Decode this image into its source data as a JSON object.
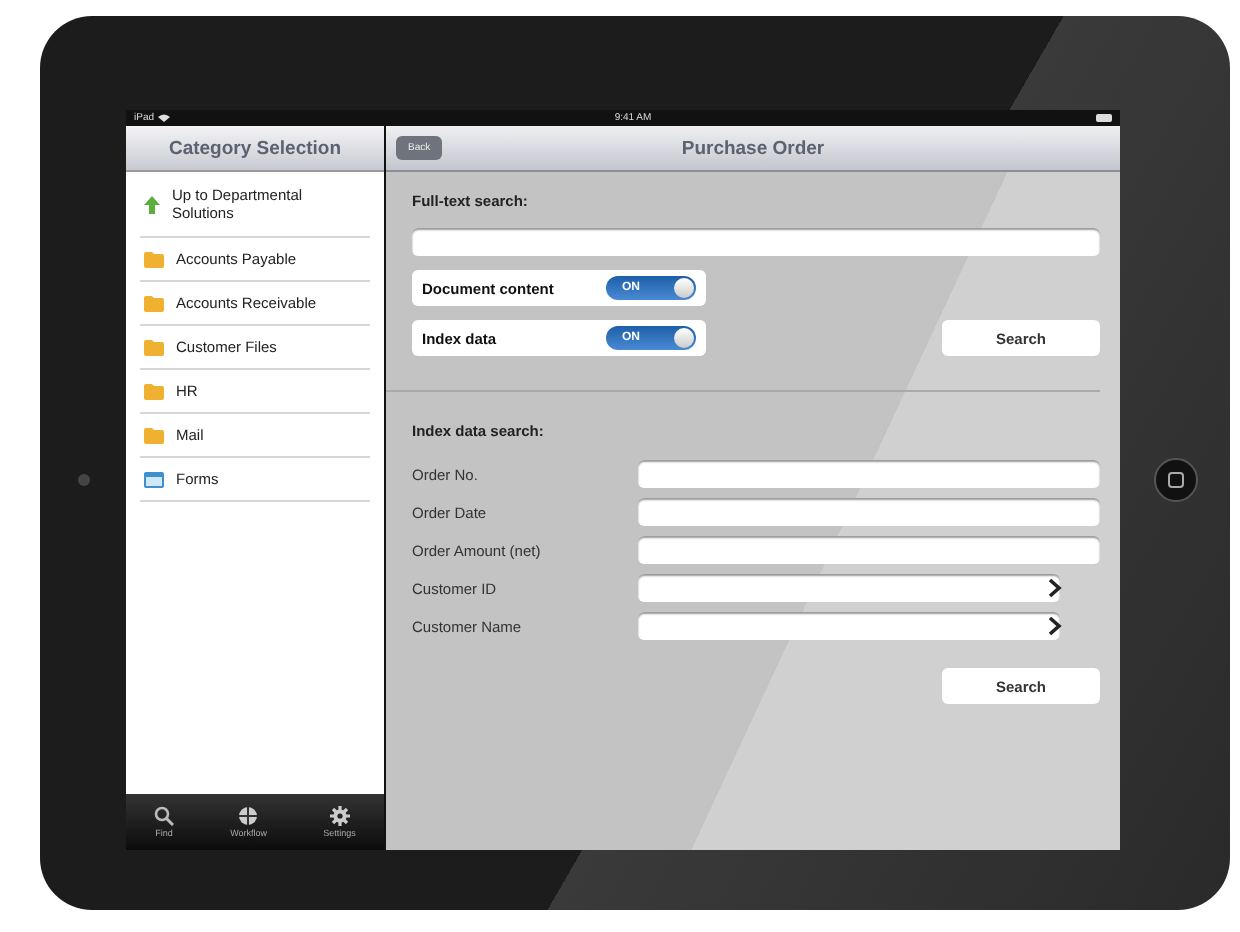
{
  "status_bar": {
    "device": "iPad",
    "time": "9:41 AM"
  },
  "sidebar": {
    "title": "Category Selection",
    "items": [
      {
        "label": "Up to Departmental Solutions",
        "kind": "up"
      },
      {
        "label": "Accounts Payable",
        "kind": "folder"
      },
      {
        "label": "Accounts Receivable",
        "kind": "folder"
      },
      {
        "label": "Customer Files",
        "kind": "folder"
      },
      {
        "label": "HR",
        "kind": "folder"
      },
      {
        "label": "Mail",
        "kind": "folder"
      },
      {
        "label": "Forms",
        "kind": "form"
      }
    ],
    "tabs": [
      {
        "label": "Find",
        "kind": "find"
      },
      {
        "label": "Workflow",
        "kind": "workflow"
      },
      {
        "label": "Settings",
        "kind": "settings"
      }
    ]
  },
  "nav": {
    "back": "Back",
    "title": "Purchase Order"
  },
  "full_text": {
    "heading": "Full-text search:",
    "toggles": [
      {
        "label": "Document content",
        "on": true,
        "state_text": "ON"
      },
      {
        "label": "Index data",
        "on": true,
        "state_text": "ON"
      }
    ],
    "button": "Search"
  },
  "index_search": {
    "heading": "Index data search:",
    "fields": [
      {
        "label": "Order No.",
        "chevron": false
      },
      {
        "label": "Order Date",
        "chevron": false
      },
      {
        "label": "Order Amount (net)",
        "chevron": false
      },
      {
        "label": "Customer ID",
        "chevron": true
      },
      {
        "label": "Customer Name",
        "chevron": true
      }
    ],
    "button": "Search"
  }
}
